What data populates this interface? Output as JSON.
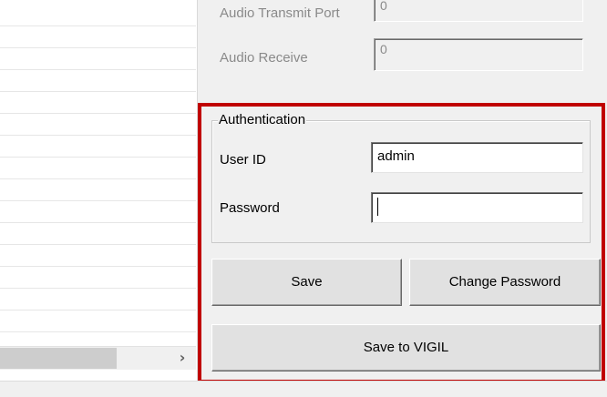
{
  "network": {
    "audio_transmit_port_label": "Audio Transmit Port",
    "audio_transmit_port_value": "0",
    "audio_receive_label": "Audio Receive",
    "audio_receive_value": "0"
  },
  "authentication": {
    "group_label": "Authentication",
    "user_id_label": "User ID",
    "user_id_value": "admin",
    "password_label": "Password",
    "password_value": ""
  },
  "buttons": {
    "save": "Save",
    "change_password": "Change Password",
    "save_to_vigil": "Save to VIGIL"
  },
  "scrollbar": {
    "right_arrow_icon": "chevron-right-icon",
    "right_arrow_glyph": "›"
  },
  "colors": {
    "highlight": "#c00000",
    "window_bg": "#f0f0f0",
    "disabled_text": "#8a8a8a"
  }
}
